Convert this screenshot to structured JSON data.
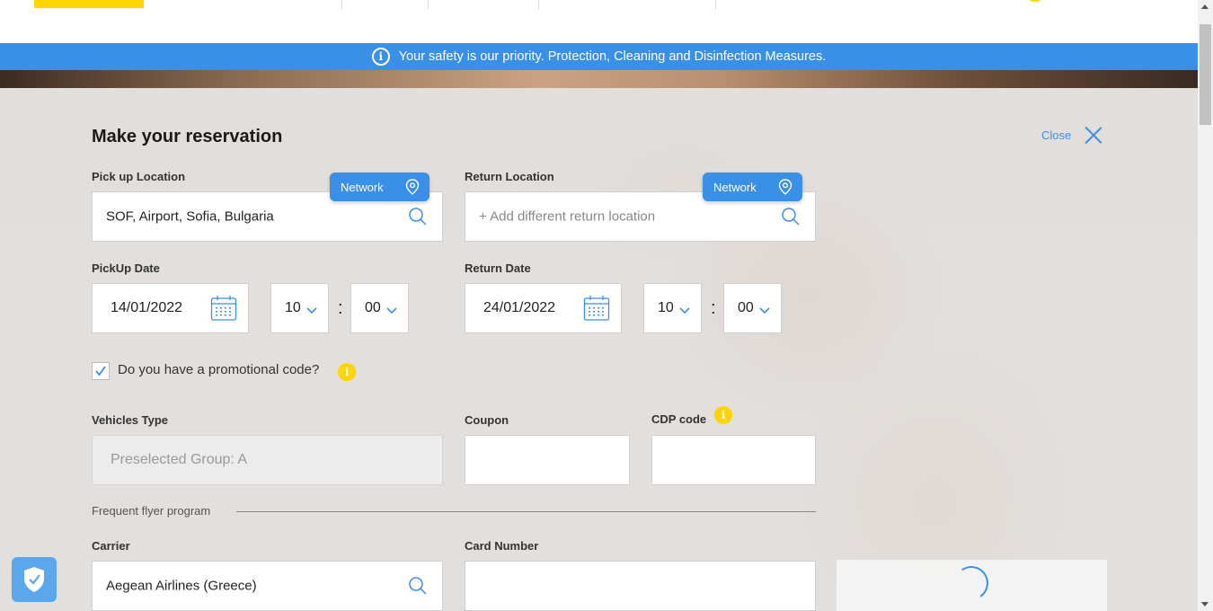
{
  "banner": {
    "text": "Your safety is our priority. Protection, Cleaning and Disinfection Measures.",
    "icon": "info-circle-icon",
    "color": "#3a8fe6"
  },
  "form": {
    "title": "Make your reservation",
    "close_label": "Close",
    "pickup_location": {
      "label": "Pick up Location",
      "value": "SOF, Airport, Sofia, Bulgaria",
      "network_label": "Network"
    },
    "return_location": {
      "label": "Return Location",
      "placeholder": "+ Add different return location",
      "network_label": "Network"
    },
    "pickup_date": {
      "label": "PickUp Date",
      "date": "14/01/2022",
      "hour": "10",
      "minute": "00"
    },
    "return_date": {
      "label": "Return Date",
      "date": "24/01/2022",
      "hour": "10",
      "minute": "00"
    },
    "time_separator": ":",
    "promo": {
      "checked": true,
      "label": "Do you have a promotional code?",
      "info": "i"
    },
    "vehicles_type": {
      "label": "Vehicles Type",
      "value": "Preselected Group: A"
    },
    "coupon": {
      "label": "Coupon",
      "value": ""
    },
    "cdp": {
      "label": "CDP code",
      "value": "",
      "info": "i"
    },
    "ffp": {
      "label": "Frequent flyer program"
    },
    "carrier": {
      "label": "Carrier",
      "value": "Aegean Airlines (Greece)"
    },
    "card_number": {
      "label": "Card Number",
      "value": ""
    }
  },
  "colors": {
    "accent": "#3a8fe6",
    "brand_yellow": "#ffd400"
  }
}
